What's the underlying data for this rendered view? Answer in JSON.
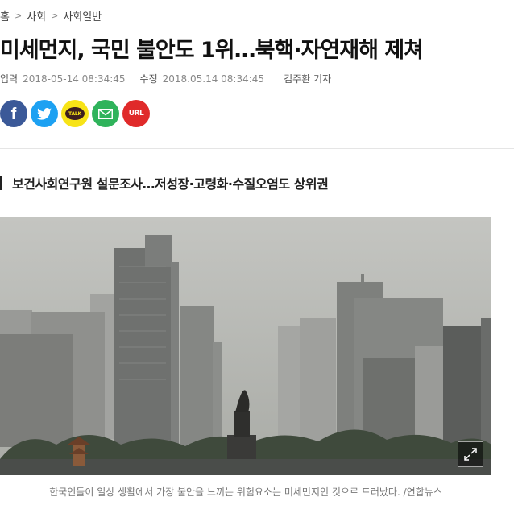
{
  "breadcrumb": {
    "home": "홈",
    "section": "사회",
    "subsection": "사회일반",
    "separator": ">"
  },
  "article": {
    "headline": "미세먼지, 국민 불안도 1위…북핵·자연재해 제쳐",
    "meta": {
      "input_label": "입력",
      "input_time": "2018-05-14 08:34:45",
      "edit_label": "수정",
      "edit_time": "2018.05.14 08:34:45",
      "reporter": "김주환 기자"
    },
    "subheadline": "보건사회연구원 설문조사…저성장·고령화·수질오염도 상위권",
    "photo_caption": "한국인들이 일상 생활에서 가장 불안을 느끼는 위험요소는 미세먼지인 것으로 드러났다. /연합뉴스"
  },
  "share": {
    "facebook": "f",
    "kakao": "TALK",
    "url": "URL"
  },
  "colors": {
    "facebook": "#3b5998",
    "twitter": "#1da1f2",
    "kakao": "#f7e317",
    "email": "#2fb35b",
    "url": "#e02a2a"
  },
  "icons": [
    "facebook-icon",
    "twitter-icon",
    "kakaotalk-icon",
    "email-icon",
    "url-icon",
    "expand-icon"
  ]
}
